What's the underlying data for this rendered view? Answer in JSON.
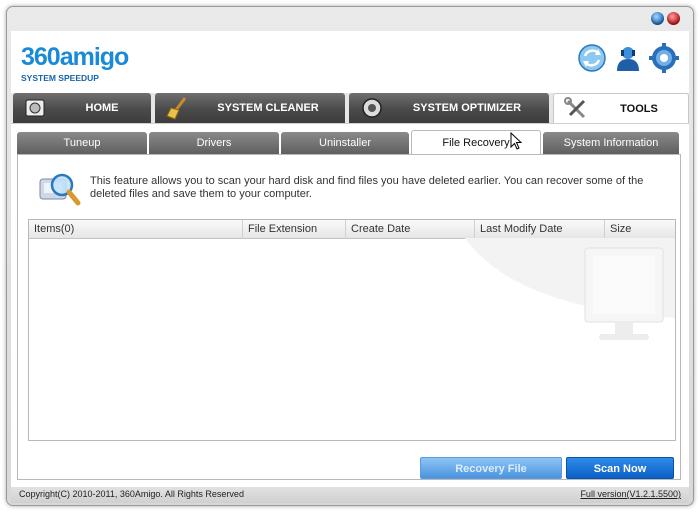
{
  "brand": {
    "logo_main": "360amigo",
    "logo_sub": "SYSTEM SPEEDUP"
  },
  "window_controls": [
    "minimize-icon",
    "close-icon"
  ],
  "header_icons": [
    "refresh-icon",
    "support-agent-icon",
    "settings-gear-icon"
  ],
  "main_nav": {
    "tabs": [
      {
        "label": "HOME",
        "icon": "home-disk-icon",
        "active": false
      },
      {
        "label": "SYSTEM CLEANER",
        "icon": "broom-icon",
        "active": false
      },
      {
        "label": "SYSTEM OPTIMIZER",
        "icon": "gear-icon",
        "active": false
      },
      {
        "label": "TOOLS",
        "icon": "tools-icon",
        "active": true
      }
    ]
  },
  "sub_nav": {
    "tabs": [
      {
        "label": "Tuneup",
        "active": false
      },
      {
        "label": "Drivers",
        "active": false
      },
      {
        "label": "Uninstaller",
        "active": false
      },
      {
        "label": "File Recovery",
        "active": true
      },
      {
        "label": "System Information",
        "active": false
      }
    ]
  },
  "file_recovery": {
    "description": "This feature allows you to scan your hard disk and find files you have deleted earlier. You can recover some of the deleted files and save them to your computer.",
    "columns": [
      "Items(0)",
      "File Extension",
      "Create Date",
      "Last Modify Date",
      "Size"
    ],
    "rows": [],
    "buttons": {
      "recovery": "Recovery File",
      "scan": "Scan Now"
    }
  },
  "footer": {
    "copyright": "Copyright(C) 2010-2011, 360Amigo. All Rights Reserved",
    "version": "Full version(V1.2.1.5500)"
  },
  "colors": {
    "accent": "#1a8ad8",
    "scan_button": "#0b5fc6",
    "nav_dark": "#4a4a4a"
  }
}
